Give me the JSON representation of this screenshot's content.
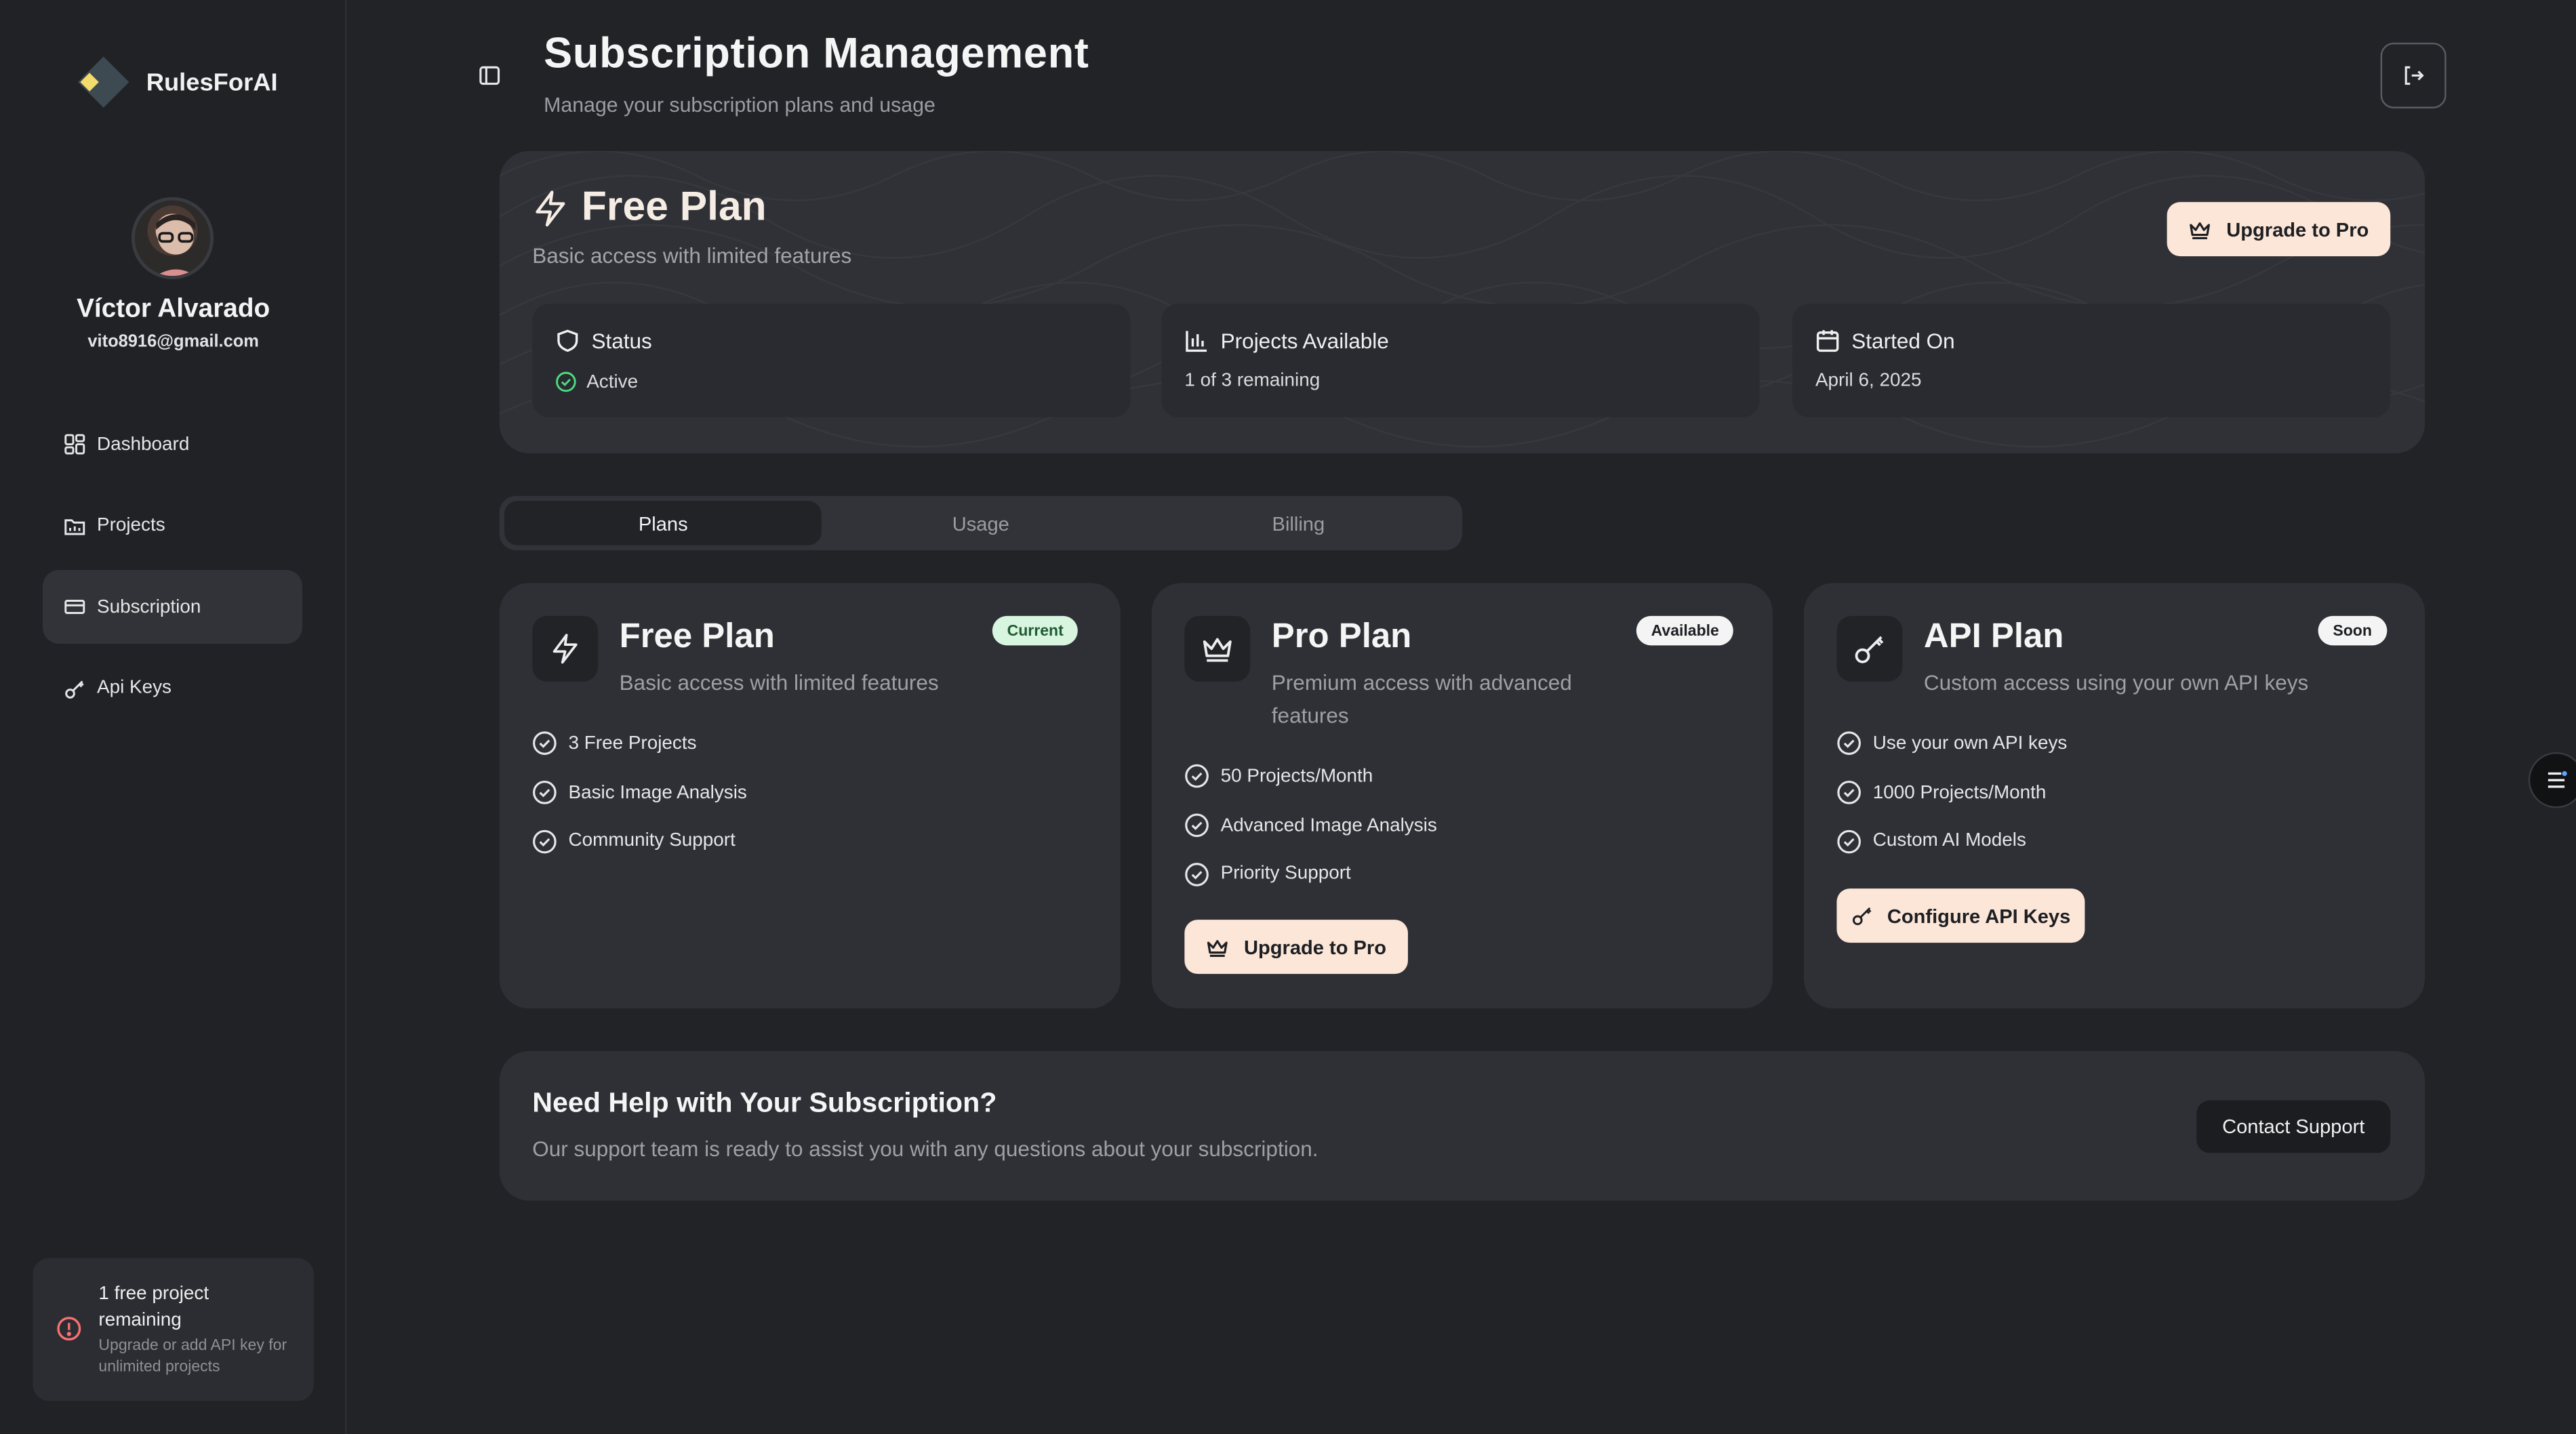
{
  "app": {
    "name": "RulesForAI",
    "logo_icon": "diamond-logo-icon",
    "accent_color": "#fbe6d8",
    "success_color": "#4ade80",
    "warning_color": "#f87171"
  },
  "user": {
    "name": "Víctor Alvarado",
    "email": "vito8916@gmail.com"
  },
  "sidebar": {
    "items": [
      {
        "label": "Dashboard",
        "icon": "grid-icon",
        "active": false
      },
      {
        "label": "Projects",
        "icon": "folder-icon",
        "active": false
      },
      {
        "label": "Subscription",
        "icon": "card-icon",
        "active": true
      },
      {
        "label": "Api Keys",
        "icon": "key-icon",
        "active": false
      }
    ],
    "notice": {
      "title": "1 free project remaining",
      "subtitle": "Upgrade or add API key for unlimited projects"
    }
  },
  "header": {
    "title": "Subscription Management",
    "subtitle": "Manage your subscription plans and usage"
  },
  "current_plan": {
    "title": "Free Plan",
    "subtitle": "Basic access with limited features",
    "upgrade_label": "Upgrade to Pro",
    "stats": [
      {
        "label": "Status",
        "value": "Active",
        "icon": "shield-icon"
      },
      {
        "label": "Projects Available",
        "value": "1 of 3 remaining",
        "icon": "bar-chart-icon"
      },
      {
        "label": "Started On",
        "value": "April 6, 2025",
        "icon": "calendar-icon"
      }
    ]
  },
  "tabs": [
    {
      "label": "Plans",
      "active": true
    },
    {
      "label": "Usage",
      "active": false
    },
    {
      "label": "Billing",
      "active": false
    }
  ],
  "plans": [
    {
      "name": "Free Plan",
      "description": "Basic access with limited features",
      "badge": "Current",
      "icon": "lightning-icon",
      "features": [
        "3 Free Projects",
        "Basic Image Analysis",
        "Community Support"
      ],
      "button": ""
    },
    {
      "name": "Pro Plan",
      "description": "Premium access with advanced features",
      "badge": "Available",
      "icon": "crown-icon",
      "features": [
        "50 Projects/Month",
        "Advanced Image Analysis",
        "Priority Support"
      ],
      "button": "Upgrade to Pro"
    },
    {
      "name": "API Plan",
      "description": "Custom access using your own API keys",
      "badge": "Soon",
      "icon": "key-icon",
      "features": [
        "Use your own API keys",
        "1000 Projects/Month",
        "Custom AI Models"
      ],
      "button": "Configure API Keys"
    }
  ],
  "help": {
    "title": "Need Help with Your Subscription?",
    "subtitle": "Our support team is ready to assist you with any questions about your subscription.",
    "button": "Contact Support"
  }
}
